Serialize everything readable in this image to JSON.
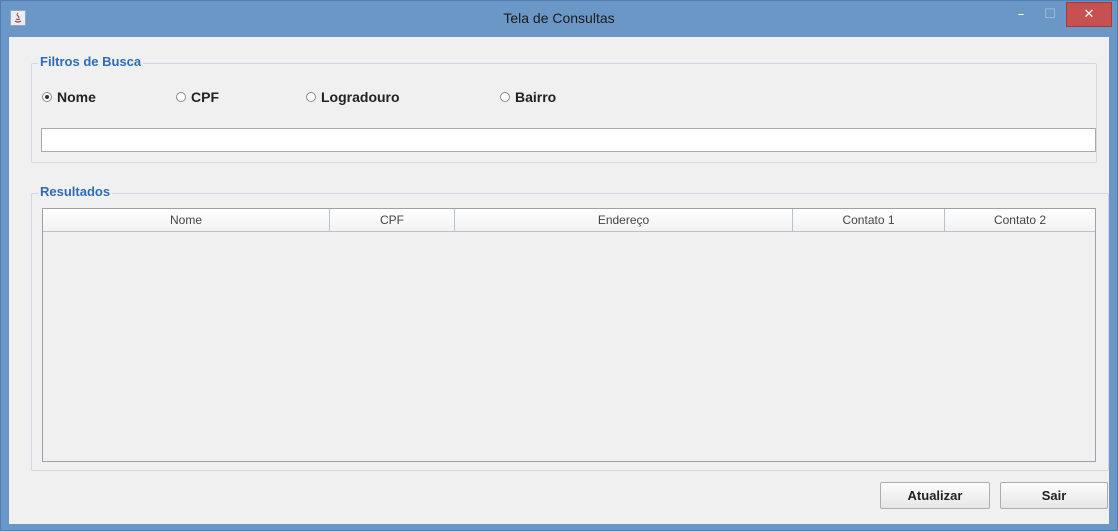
{
  "window": {
    "title": "Tela de Consultas",
    "minimize_glyph": "–",
    "maximize_glyph": "☐",
    "close_glyph": "✕",
    "app_icon": "java-icon"
  },
  "filters": {
    "title": "Filtros de Busca",
    "options": [
      {
        "label": "Nome",
        "checked": true
      },
      {
        "label": "CPF",
        "checked": false
      },
      {
        "label": "Logradouro",
        "checked": false
      },
      {
        "label": "Bairro",
        "checked": false
      }
    ],
    "search_value": ""
  },
  "results": {
    "title": "Resultados",
    "columns": [
      "Nome",
      "CPF",
      "Endereço",
      "Contato 1",
      "Contato 2"
    ],
    "rows": []
  },
  "buttons": {
    "refresh_label": "Atualizar",
    "exit_label": "Sair"
  },
  "colors": {
    "titlebar": "#6b97c7",
    "group_title": "#2e6bb9",
    "close_button": "#c75050"
  }
}
